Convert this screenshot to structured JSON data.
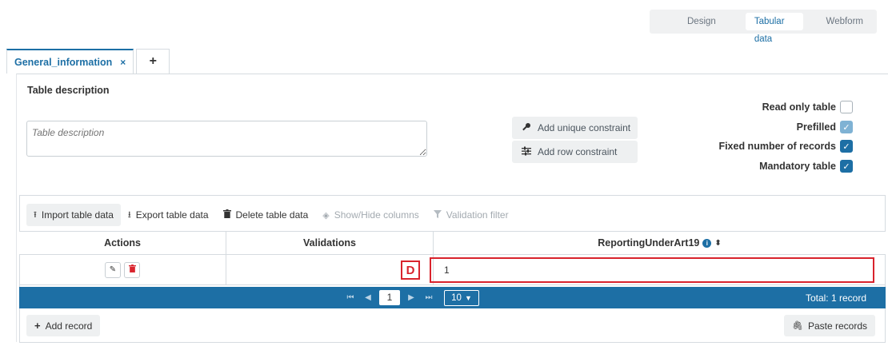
{
  "view_switch": {
    "design": "Design",
    "tabular": "Tabular data",
    "webform": "Webform",
    "active": "tabular"
  },
  "tabs": [
    {
      "label": "General_information",
      "close": "×"
    }
  ],
  "add_tab_label": "+",
  "table_description": {
    "label": "Table description",
    "placeholder": "Table description"
  },
  "constraints": {
    "unique": "Add unique constraint",
    "row": "Add row constraint"
  },
  "options": [
    {
      "label": "Read only table",
      "checked": false
    },
    {
      "label": "Prefilled",
      "checked": true
    },
    {
      "label": "Fixed number of records",
      "checked": true
    },
    {
      "label": "Mandatory table",
      "checked": true
    }
  ],
  "toolbar": {
    "import": "Import table data",
    "export": "Export table data",
    "delete": "Delete table data",
    "columns": "Show/Hide columns",
    "filter": "Validation filter"
  },
  "columns": [
    "Actions",
    "Validations",
    "ReportingUnderArt19"
  ],
  "rows": [
    {
      "validation": "",
      "value": "1"
    }
  ],
  "annotation_marker": "D",
  "pager": {
    "page": "1",
    "page_size": "10",
    "total": "Total: 1 record"
  },
  "footer": {
    "add_record": "Add record",
    "paste_records": "Paste records"
  },
  "colors": {
    "accent": "#1d6fa5",
    "danger": "#d9232d"
  }
}
